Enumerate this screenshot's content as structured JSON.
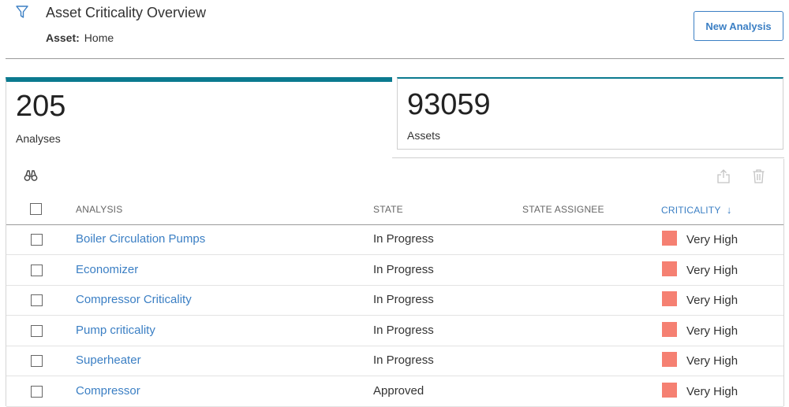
{
  "header": {
    "title": "Asset Criticality Overview",
    "asset_label": "Asset:",
    "asset_value": "Home",
    "new_analysis_label": "New Analysis"
  },
  "tiles": {
    "analyses": {
      "count": "205",
      "label": "Analyses"
    },
    "assets": {
      "count": "93059",
      "label": "Assets"
    }
  },
  "icons": {
    "filter": "filter-icon",
    "search": "binoculars-icon",
    "export": "export-icon",
    "delete": "trash-icon",
    "sort": "arrow-down-icon"
  },
  "colors": {
    "accent": "#0b7a8f",
    "link": "#3b7fc4",
    "very_high": "#f58072"
  },
  "table": {
    "columns": {
      "analysis": "ANALYSIS",
      "state": "STATE",
      "state_assignee": "STATE ASSIGNEE",
      "criticality": "CRITICALITY"
    },
    "sort_indicator": "↓",
    "rows": [
      {
        "analysis": "Boiler Circulation Pumps",
        "state": "In Progress",
        "assignee": "",
        "criticality": "Very High"
      },
      {
        "analysis": "Economizer",
        "state": "In Progress",
        "assignee": "",
        "criticality": "Very High"
      },
      {
        "analysis": "Compressor Criticality",
        "state": "In Progress",
        "assignee": "",
        "criticality": "Very High"
      },
      {
        "analysis": "Pump criticality",
        "state": "In Progress",
        "assignee": "",
        "criticality": "Very High"
      },
      {
        "analysis": "Superheater",
        "state": "In Progress",
        "assignee": "",
        "criticality": "Very High"
      },
      {
        "analysis": "Compressor",
        "state": "Approved",
        "assignee": "",
        "criticality": "Very High"
      }
    ]
  }
}
